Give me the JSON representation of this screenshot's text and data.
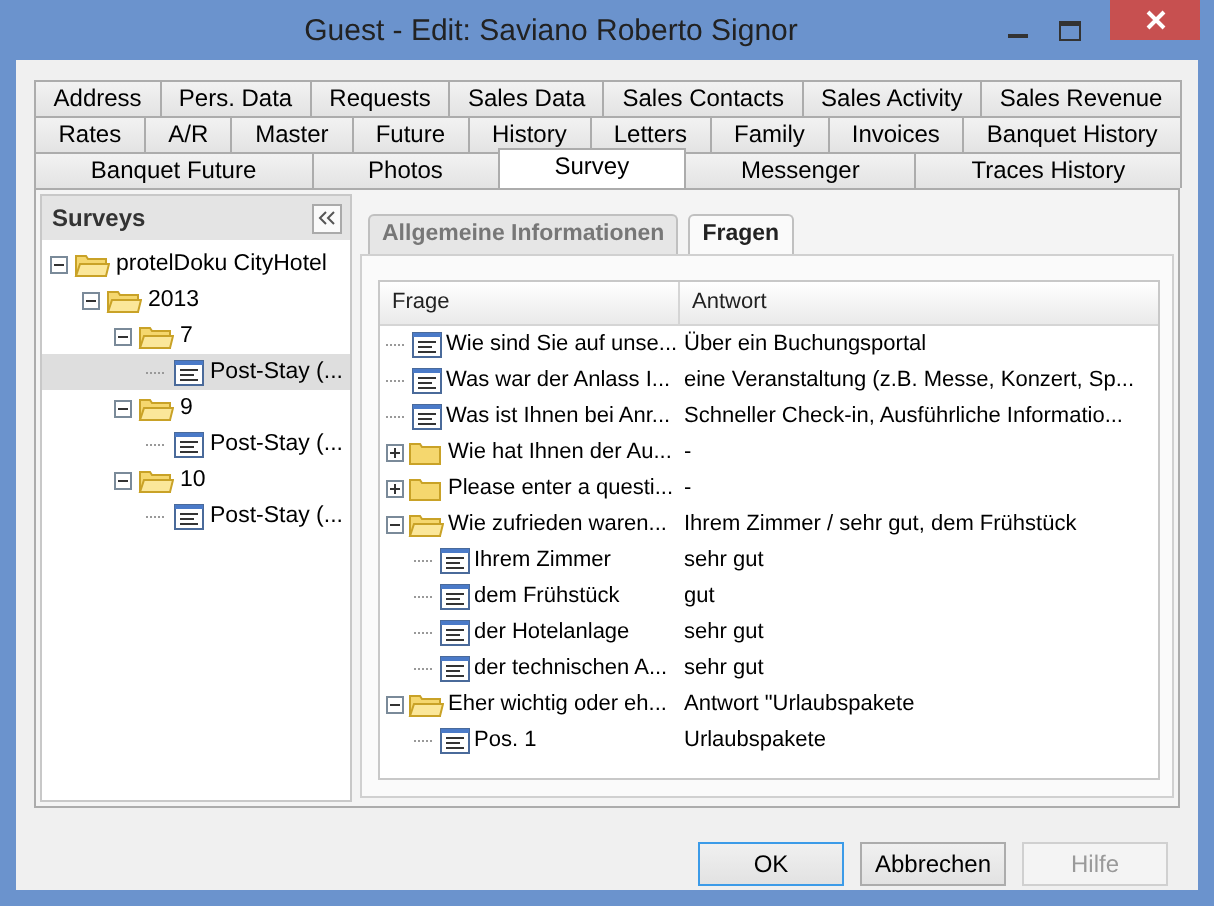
{
  "window": {
    "title": "Guest - Edit: Saviano Roberto Signor"
  },
  "tab_rows": [
    [
      {
        "label": "Address",
        "selected": false
      },
      {
        "label": "Pers. Data",
        "selected": false
      },
      {
        "label": "Requests",
        "selected": false
      },
      {
        "label": "Sales Data",
        "selected": false
      },
      {
        "label": "Sales Contacts",
        "selected": false
      },
      {
        "label": "Sales Activity",
        "selected": false
      },
      {
        "label": "Sales Revenue",
        "selected": false
      }
    ],
    [
      {
        "label": "Rates",
        "selected": false
      },
      {
        "label": "A/R",
        "selected": false
      },
      {
        "label": "Master",
        "selected": false
      },
      {
        "label": "Future",
        "selected": false
      },
      {
        "label": "History",
        "selected": false
      },
      {
        "label": "Letters",
        "selected": false
      },
      {
        "label": "Family",
        "selected": false
      },
      {
        "label": "Invoices",
        "selected": false
      },
      {
        "label": "Banquet History",
        "selected": false
      }
    ],
    [
      {
        "label": "Banquet Future",
        "selected": false
      },
      {
        "label": "Photos",
        "selected": false
      },
      {
        "label": "Survey",
        "selected": true
      },
      {
        "label": "Messenger",
        "selected": false
      },
      {
        "label": "Traces History",
        "selected": false
      }
    ]
  ],
  "surveys": {
    "title": "Surveys",
    "tree": [
      {
        "label": "protelDoku CityHotel",
        "kind": "folder",
        "expanded": true,
        "selected": false,
        "children": [
          {
            "label": "2013",
            "kind": "folder",
            "expanded": true,
            "selected": false,
            "children": [
              {
                "label": "7",
                "kind": "folder",
                "expanded": true,
                "selected": false,
                "children": [
                  {
                    "label": "Post-Stay (...",
                    "kind": "item",
                    "selected": true
                  }
                ]
              },
              {
                "label": "9",
                "kind": "folder",
                "expanded": true,
                "selected": false,
                "children": [
                  {
                    "label": "Post-Stay (...",
                    "kind": "item",
                    "selected": false
                  }
                ]
              },
              {
                "label": "10",
                "kind": "folder",
                "expanded": true,
                "selected": false,
                "children": [
                  {
                    "label": "Post-Stay (...",
                    "kind": "item",
                    "selected": false
                  }
                ]
              }
            ]
          }
        ]
      }
    ]
  },
  "inner_tabs": [
    {
      "label": "Allgemeine Informationen",
      "selected": false
    },
    {
      "label": "Fragen",
      "selected": true
    }
  ],
  "questions": {
    "columns": [
      "Frage",
      "Antwort"
    ],
    "rows": [
      {
        "question": "Wie sind Sie auf unse...",
        "answer": "Über ein Buchungsportal",
        "kind": "item"
      },
      {
        "question": "Was war der Anlass I...",
        "answer": "eine Veranstaltung (z.B. Messe, Konzert, Sp...",
        "kind": "item"
      },
      {
        "question": "Was ist Ihnen bei Anr...",
        "answer": "Schneller Check-in, Ausführliche Informatio...",
        "kind": "item"
      },
      {
        "question": "Wie hat Ihnen der Au...",
        "answer": "-",
        "kind": "folder",
        "expanded": false
      },
      {
        "question": "Please enter a questi...",
        "answer": "-",
        "kind": "folder",
        "expanded": false
      },
      {
        "question": "Wie zufrieden waren...",
        "answer": "Ihrem Zimmer / sehr gut, dem Frühstück",
        "kind": "folder",
        "expanded": true,
        "children": [
          {
            "question": "Ihrem Zimmer",
            "answer": "sehr gut",
            "kind": "item"
          },
          {
            "question": "dem Frühstück",
            "answer": "gut",
            "kind": "item"
          },
          {
            "question": "der Hotelanlage",
            "answer": "sehr gut",
            "kind": "item"
          },
          {
            "question": "der technischen A...",
            "answer": "sehr gut",
            "kind": "item"
          }
        ]
      },
      {
        "question": "Eher wichtig oder eh...",
        "answer": "Antwort \"Urlaubspakete",
        "kind": "folder",
        "expanded": true,
        "children": [
          {
            "question": "Pos. 1",
            "answer": "Urlaubspakete",
            "kind": "item"
          }
        ]
      }
    ]
  },
  "buttons": [
    {
      "label": "OK",
      "focused": true,
      "disabled": false
    },
    {
      "label": "Abbrechen",
      "focused": false,
      "disabled": false
    },
    {
      "label": "Hilfe",
      "focused": false,
      "disabled": true
    }
  ]
}
